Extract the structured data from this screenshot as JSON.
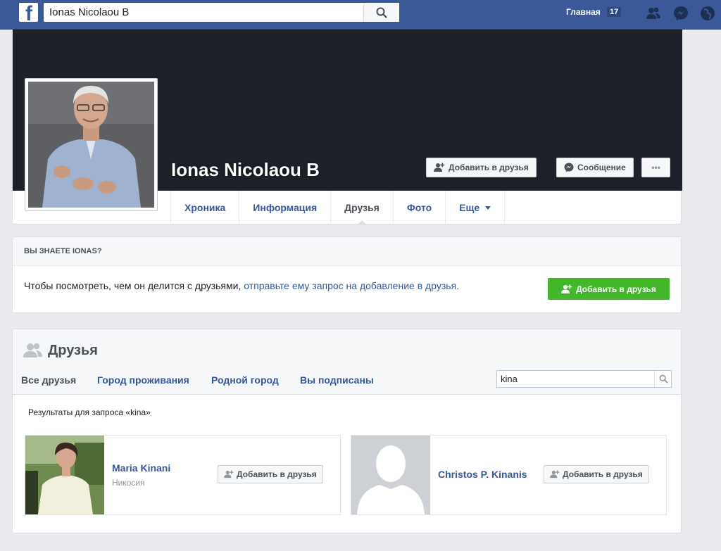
{
  "topbar": {
    "logo_letter": "f",
    "search_value": "Ionas Nicolaou B",
    "home_label": "Главная",
    "home_count": "17",
    "icons": [
      "friend-requests-icon",
      "messenger-icon",
      "notifications-globe-icon"
    ]
  },
  "profile": {
    "name": "Ionas Nicolaou B",
    "add_friend_label": "Добавить в друзья",
    "message_label": "Сообщение",
    "more_label": "•••",
    "tabs": [
      {
        "label": "Хроника"
      },
      {
        "label": "Информация"
      },
      {
        "label": "Друзья"
      },
      {
        "label": "Фото"
      },
      {
        "label": "Еще"
      }
    ]
  },
  "know": {
    "heading": "ВЫ ЗНАЕТЕ IONAS?",
    "text": "Чтобы посмотреть, чем он делится с друзьями,",
    "link": "отправьте ему запрос на добавление в друзья.",
    "button_label": "Добавить в друзья"
  },
  "friends": {
    "title": "Друзья",
    "tabs": [
      {
        "label": "Все друзья"
      },
      {
        "label": "Город проживания"
      },
      {
        "label": "Родной город"
      },
      {
        "label": "Вы подписаны"
      }
    ],
    "search_value": "kina",
    "results_label": "Результаты для запроса «kina»",
    "items": [
      {
        "name": "Maria Kinani",
        "location": "Никосия",
        "button_label": "Добавить в друзья"
      },
      {
        "name": "Christos P. Kinanis",
        "location": "",
        "button_label": "Добавить в друзья"
      }
    ]
  },
  "colors": {
    "brand": "#3b5998",
    "link": "#365899",
    "green": "#42b72a",
    "cover": "#1d2129"
  }
}
